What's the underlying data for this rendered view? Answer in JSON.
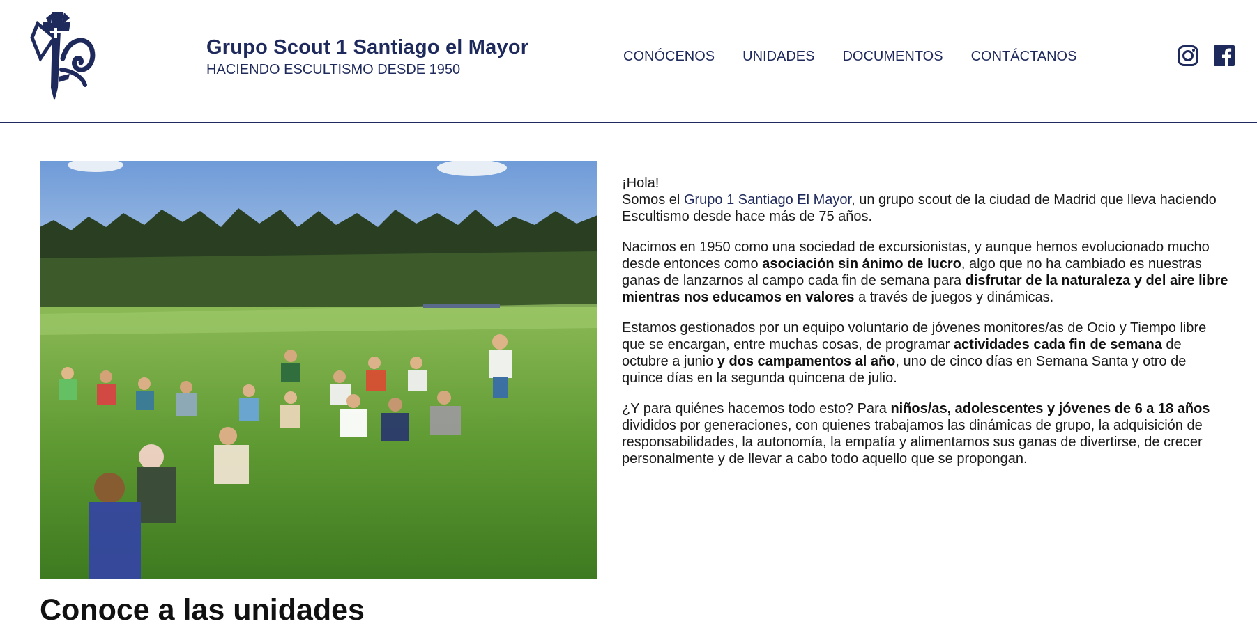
{
  "header": {
    "title": "Grupo Scout 1 Santiago el Mayor",
    "subtitle": "HACIENDO ESCULTISMO DESDE 1950"
  },
  "nav": {
    "items": [
      "CONÓCENOS",
      "UNIDADES",
      "DOCUMENTOS",
      "CONTÁCTANOS"
    ]
  },
  "social": {
    "icons": [
      "instagram-icon",
      "facebook-icon"
    ]
  },
  "colors": {
    "brand": "#1f2a5c"
  },
  "intro": {
    "greeting": "¡Hola!",
    "p1_a": "Somos el ",
    "p1_hl": "Grupo 1 Santiago El Mayor",
    "p1_b": ", un grupo scout de la ciudad de Madrid que lleva haciendo Escultismo desde hace más de 75 años.",
    "p2_a": "Nacimos en 1950 como una sociedad de excursionistas, y aunque hemos evolucionado mucho desde entonces como ",
    "p2_b1": "asociación sin ánimo de lucro",
    "p2_c": ", algo que no ha cambiado es nuestras ganas de lanzarnos al campo cada fin de semana para ",
    "p2_b2": "disfrutar de la naturaleza y del aire libre mientras nos educamos en valores",
    "p2_d": " a través de juegos y dinámicas.",
    "p3_a": "Estamos gestionados por un equipo voluntario de jóvenes monitores/as de Ocio y Tiempo libre que se encargan, entre muchas cosas, de programar ",
    "p3_b1": "actividades cada fin de semana",
    "p3_c": " de octubre a junio ",
    "p3_b2": "y dos campamentos al año",
    "p3_d": ", uno de cinco días en Semana Santa y otro de quince días en la segunda quincena de julio.",
    "p4_a": "¿Y para quiénes hacemos todo esto? Para ",
    "p4_b": "niños/as, adolescentes y jóvenes de 6 a 18 años",
    "p4_c": " divididos por generaciones, con quienes trabajamos las dinámicas de grupo, la adquisición de responsabilidades, la autonomía, la empatía y alimentamos sus ganas de divertirse, de crecer personalmente y de llevar a cabo todo aquello que se propongan."
  },
  "section": {
    "title": "Conoce a las unidades"
  }
}
